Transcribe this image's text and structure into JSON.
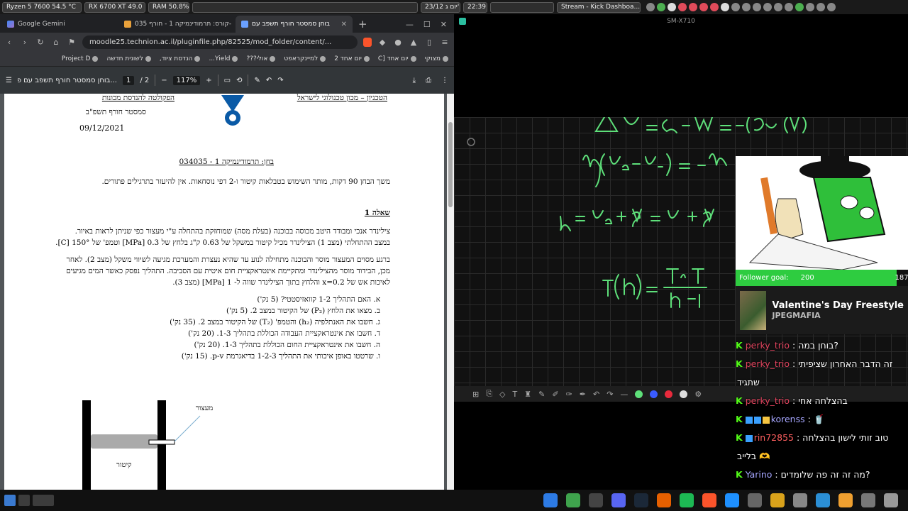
{
  "topbar": {
    "cpu": "Ryzen 5 7600   54.5 °C",
    "gpu": "RX 6700 XT 49.0 °C",
    "ram": "RAM   50.8%",
    "date": "23/12 יום ג'",
    "time": "22:39",
    "window_title": "Stream - Kick Dashboa..."
  },
  "browser": {
    "tabs": [
      {
        "label": "Google Gemini"
      },
      {
        "label": "קורס: תרמודינמיקה 1 - חורף 035-"
      },
      {
        "label": "בוחן סמסטר חורף תשפב עם"
      }
    ],
    "url": "moodle25.technion.ac.il/pluginfile.php/82525/mod_folder/content/...",
    "bookmarks": [
      "מצוקי",
      "יום אחד [C",
      "יום אחד 2",
      "למיינקראפט",
      "אולי???",
      "Yield...",
      "הנדסת ציוד,",
      "לשונית חדשה",
      "Project D"
    ],
    "pdf": {
      "title": "...בוחן סמסטר חורף תשפב עם פתרון",
      "page": "1",
      "pages": "/  2",
      "zoom": "117%"
    }
  },
  "doc": {
    "header_right": "הטכניון – מכון טכנולוגי לישראל",
    "header_left": "הפקולטה להנדסת מכונות",
    "semester": "סמסטר חורף תשפ\"ב",
    "date": "09/12/2021",
    "exam_title": "בחן: תרמודינמיקה 1  -  034035",
    "instructions": "משך הבחן 90 דקות, מותר השימוש בטבלאות קיטור ו-2 דפי נוסחאות. אין להיעזר בתרגילים פתורים.",
    "q_title": "שאלה 1",
    "p1a": "צילינדר אנכי ומבודד היטב מכוסה בבוכנה (בעלת מסה) שמוחזקת בהתחלה ע\"י מעצור כפי שניתן לראות באיור.",
    "p1b": "במצב ההתחלתי (מצב 1) הצילינדר מכיל קיטור במשקל של 0.63 ק\"ג בלחץ של 0.3 [MPa] וטמפ' של 150° [C].",
    "p2a": "ברגע מסוים המעצור מוסר והבוכנה מתחילה לנוע עד שהיא נעצרת והמערכת מגיעה לשיווי משקל (מצב 2). לאחר",
    "p2b": "מכן, הבידוד מוסר מהצילינדר ומתקיימת אינטראקציית חום איטית עם הסביבה. התהליך נפסק כאשר המים מגיעים",
    "p2c": "לאיכות אש של x=0.2 והלחץ בתוך הצילינדר שווה ל- 1 [MPa] (מצב 3).",
    "items": [
      "א.   האם התהליך 1-2 קוואזיסטטי? (5 נק')",
      "ב.   מצאו את הלחץ (P₂) של הקיטור במצב 2. (5 נק')",
      "ג.   חשבו את האנתלפיה (h₂) והטמפ' (T₂) של הקיטור במצב 2. (35 נק')",
      "ד.   חשבו את אינטראקציית העבודה הכוללת בתהליך 1-3. (20 נק')",
      "ה.   חשבו את אינטראקציית החום הכוללת בתהליך 1-3. (20 נק')",
      "ו.   שרטטו באופן איכותי את התהליך 1-2-3 בדיאגרמת p-v. (15 נק')"
    ],
    "label_stopper": "מעצור",
    "label_steam": "קיטור"
  },
  "video": {
    "title": "SM-X710"
  },
  "overlay": {
    "goal_label": "Follower goal:",
    "goal_current": "187",
    "goal_max": "200",
    "goal_progress": 0.935,
    "song_title": "Valentine's Day Freestyle",
    "song_artist": "JPEGMAFIA",
    "chat": [
      {
        "user": "perky_trio",
        "text": "בוחן במה?",
        "color": "#e0445e"
      },
      {
        "user": "perky_trio",
        "text": "זה הדבר האחרון שציפיתי",
        "color": "#e0445e"
      },
      {
        "user": "",
        "text": "שתגיד",
        "color": "#ffffff"
      },
      {
        "user": "perky_trio",
        "text": "בהצלחה אחי",
        "color": "#e0445e"
      },
      {
        "user": "korenss",
        "text": "🥤",
        "color": "#a6a6ff"
      },
      {
        "user": "rin72855",
        "text": "טוב זותי לישון בהצלחה",
        "color": "#ff5f5f"
      },
      {
        "user": "",
        "text": "בלייב 🫶",
        "color": "#ffffff"
      },
      {
        "user": "Yarino",
        "text": "מה זה זה פה שלומדים?",
        "color": "#a6a6ff"
      }
    ]
  },
  "colors": {
    "ink_green": "#5ee07a",
    "kick_green": "#53fc18",
    "brave_orange": "#fb542b"
  }
}
